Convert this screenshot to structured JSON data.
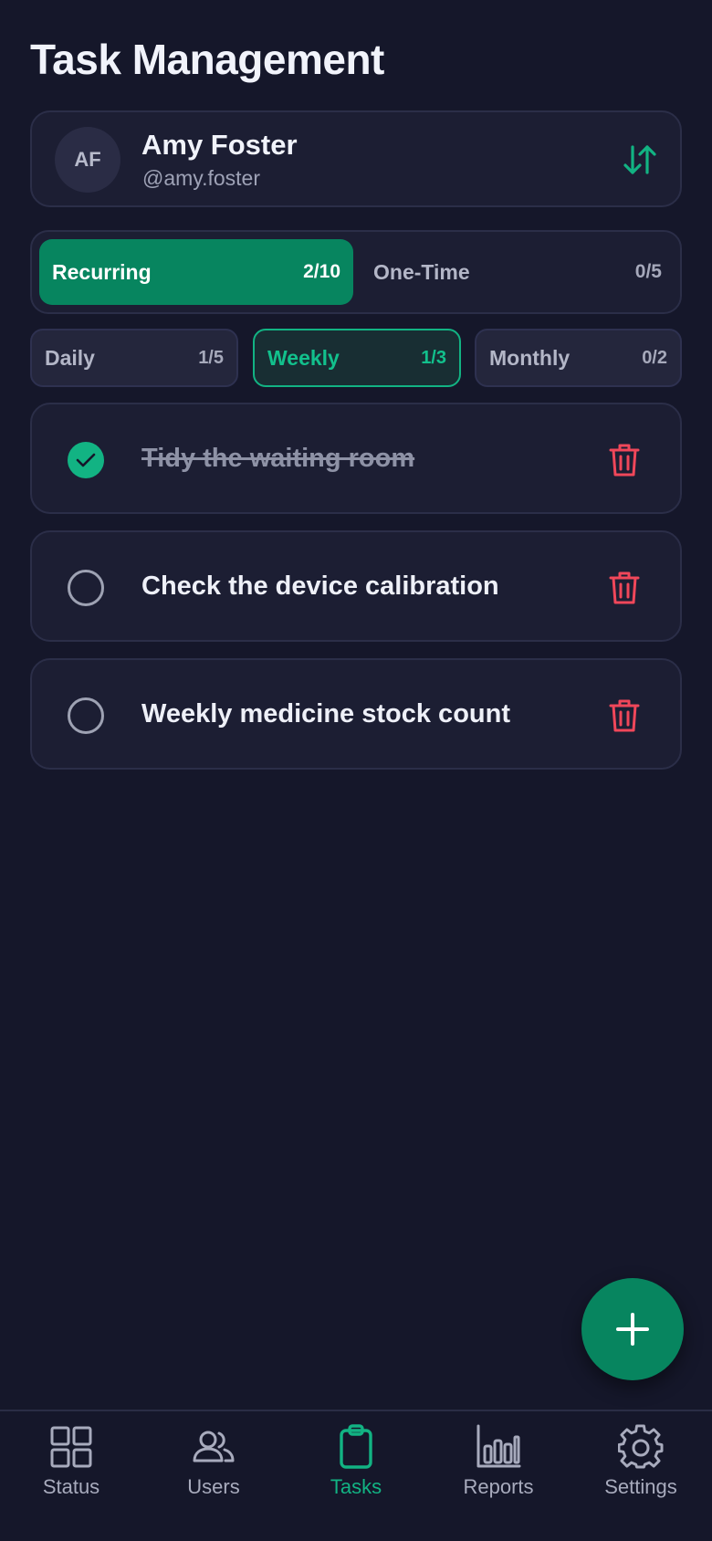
{
  "page": {
    "title": "Task Management"
  },
  "user": {
    "initials": "AF",
    "name": "Amy Foster",
    "handle": "@amy.foster"
  },
  "segments": [
    {
      "label": "Recurring",
      "count": "2/10",
      "active": true
    },
    {
      "label": "One-Time",
      "count": "0/5",
      "active": false
    }
  ],
  "frequency_tabs": [
    {
      "label": "Daily",
      "count": "1/5",
      "active": false
    },
    {
      "label": "Weekly",
      "count": "1/3",
      "active": true
    },
    {
      "label": "Monthly",
      "count": "0/2",
      "active": false
    }
  ],
  "tasks": [
    {
      "text": "Tidy the waiting room",
      "done": true
    },
    {
      "text": "Check the device calibration",
      "done": false
    },
    {
      "text": "Weekly medicine stock count",
      "done": false
    }
  ],
  "nav": [
    {
      "label": "Status",
      "icon": "grid-icon",
      "active": false
    },
    {
      "label": "Users",
      "icon": "users-icon",
      "active": false
    },
    {
      "label": "Tasks",
      "icon": "clipboard-icon",
      "active": true
    },
    {
      "label": "Reports",
      "icon": "bar-chart-icon",
      "active": false
    },
    {
      "label": "Settings",
      "icon": "gear-icon",
      "active": false
    }
  ],
  "colors": {
    "background": "#15172a",
    "card": "#1c1e33",
    "accent": "#07855f",
    "accent_bright": "#12b383",
    "danger": "#f0475a"
  }
}
